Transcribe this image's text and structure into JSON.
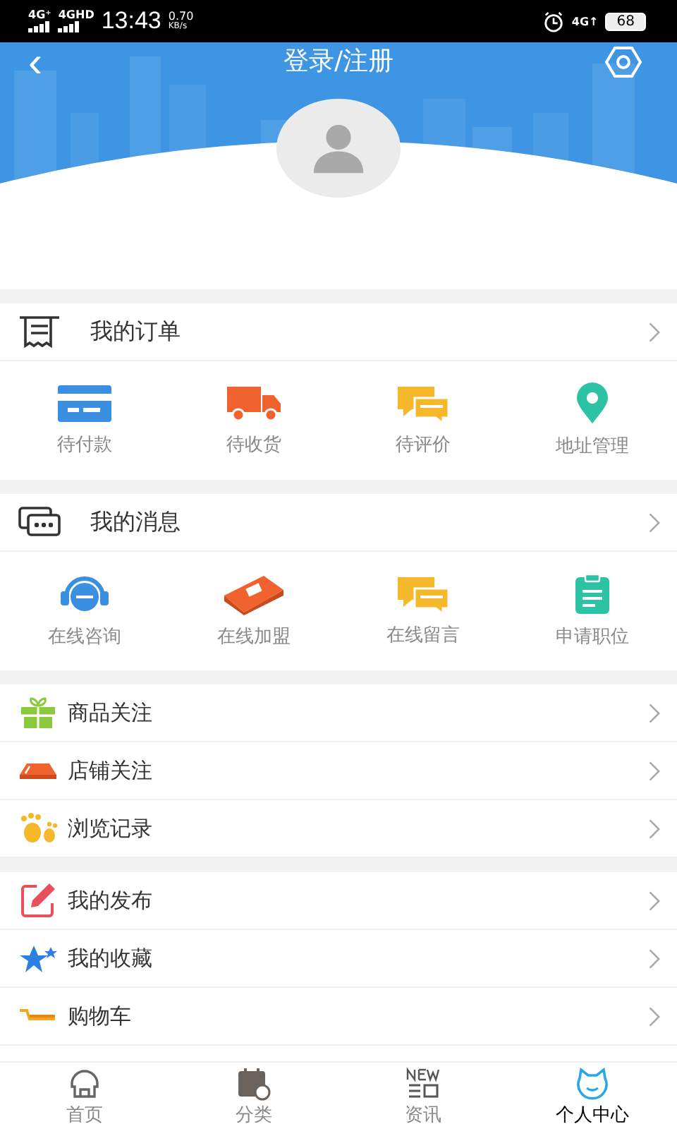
{
  "status_bar": {
    "signal_1": "4G⁺",
    "signal_2": "4GHD",
    "time": "13:43",
    "speed": "0.70",
    "speed_unit": "KB/s",
    "network": "4G↑",
    "battery": "68"
  },
  "header": {
    "back": "‹",
    "title": "登录/注册"
  },
  "sections": [
    {
      "title": "我的订单",
      "items": [
        {
          "label": "待付款",
          "color": "#3b8fe0"
        },
        {
          "label": "待收货",
          "color": "#f0622e"
        },
        {
          "label": "待评价",
          "color": "#f5b82a"
        },
        {
          "label": "地址管理",
          "color": "#2cc3a5"
        }
      ]
    },
    {
      "title": "我的消息",
      "items": [
        {
          "label": "在线咨询",
          "color": "#3b8fe0"
        },
        {
          "label": "在线加盟",
          "color": "#f0622e"
        },
        {
          "label": "在线留言",
          "color": "#f5b82a"
        },
        {
          "label": "申请职位",
          "color": "#2cc3a5"
        }
      ]
    }
  ],
  "list_groups": [
    [
      {
        "label": "商品关注"
      },
      {
        "label": "店铺关注"
      },
      {
        "label": "浏览记录"
      }
    ],
    [
      {
        "label": "我的发布"
      },
      {
        "label": "我的收藏"
      },
      {
        "label": "购物车"
      }
    ]
  ],
  "tabs": [
    {
      "label": "首页",
      "selected": false
    },
    {
      "label": "分类",
      "selected": false
    },
    {
      "label": "资讯",
      "selected": false
    },
    {
      "label": "个人中心",
      "selected": true
    }
  ]
}
